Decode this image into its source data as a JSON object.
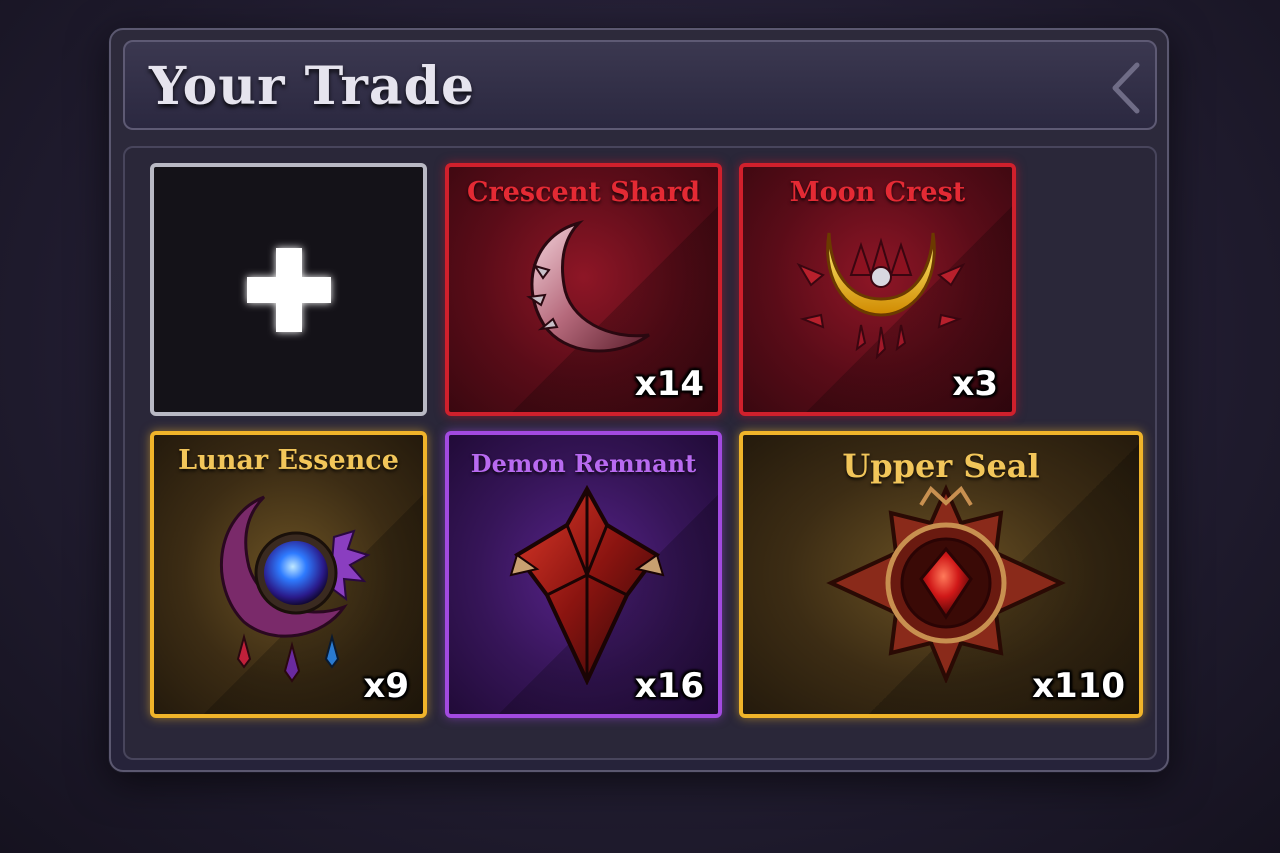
{
  "header": {
    "title": "Your Trade",
    "back_icon": "chevron-left-icon"
  },
  "add_slot": {
    "icon": "plus-icon"
  },
  "items": [
    {
      "name": "Crescent Shard",
      "quantity": "x14",
      "rarity": "red",
      "icon": "crescent-blade-icon"
    },
    {
      "name": "Moon Crest",
      "quantity": "x3",
      "rarity": "red",
      "icon": "moon-crest-icon"
    },
    {
      "name": "Lunar Essence",
      "quantity": "x9",
      "rarity": "gold",
      "icon": "lunar-orb-icon"
    },
    {
      "name": "Demon Remnant",
      "quantity": "x16",
      "rarity": "purple",
      "icon": "demon-crystal-icon"
    },
    {
      "name": "Upper Seal",
      "quantity": "x110",
      "rarity": "gold",
      "icon": "seal-emblem-icon"
    }
  ],
  "colors": {
    "red": "#d0202c",
    "gold": "#f0b42a",
    "purple": "#a24ae0",
    "empty": "#b9b9c4"
  }
}
